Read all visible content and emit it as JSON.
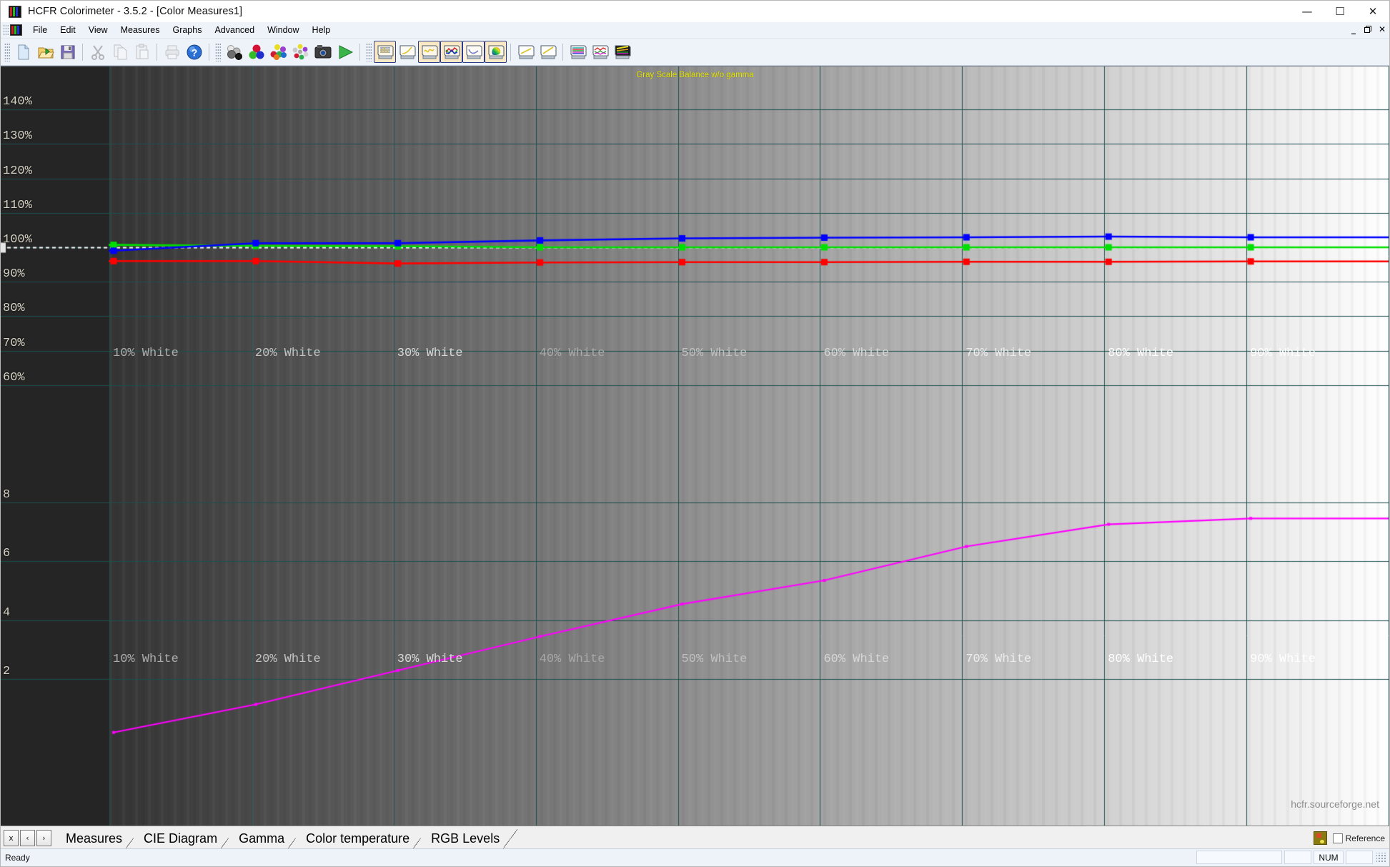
{
  "window": {
    "title": "HCFR Colorimeter - 3.5.2 - [Color Measures1]",
    "app_icon": "hcfr-rgb-icon",
    "minimize": "—",
    "maximize": "☐",
    "close": "✕"
  },
  "mdi": {
    "minimize": "_",
    "restore": "❐",
    "close": "✕"
  },
  "menu": {
    "items": [
      {
        "label": "File",
        "mnemonic": "F"
      },
      {
        "label": "Edit",
        "mnemonic": "E"
      },
      {
        "label": "View",
        "mnemonic": "V"
      },
      {
        "label": "Measures",
        "mnemonic": "M"
      },
      {
        "label": "Graphs",
        "mnemonic": "G"
      },
      {
        "label": "Advanced",
        "mnemonic": "A"
      },
      {
        "label": "Window",
        "mnemonic": "W"
      },
      {
        "label": "Help",
        "mnemonic": "H"
      }
    ]
  },
  "toolbar": {
    "groups": [
      {
        "buttons": [
          {
            "name": "new-document-icon",
            "tip": "New"
          },
          {
            "name": "open-folder-icon",
            "tip": "Open"
          },
          {
            "name": "save-floppy-icon",
            "tip": "Save"
          }
        ]
      },
      {
        "buttons": [
          {
            "name": "cut-scissors-icon",
            "tip": "Cut",
            "disabled": true
          },
          {
            "name": "copy-pages-icon",
            "tip": "Copy",
            "disabled": true
          },
          {
            "name": "paste-clipboard-icon",
            "tip": "Paste",
            "disabled": true
          }
        ]
      },
      {
        "buttons": [
          {
            "name": "print-icon",
            "tip": "Print",
            "disabled": true
          },
          {
            "name": "help-question-icon",
            "tip": "Help"
          }
        ]
      },
      {
        "buttons": [
          {
            "name": "grayscale-spheres-icon",
            "tip": "Grayscale measures"
          },
          {
            "name": "primary-colors-icon",
            "tip": "Primary colors"
          },
          {
            "name": "secondary-colors-icon",
            "tip": "Secondary colors"
          },
          {
            "name": "color-ring-icon",
            "tip": "Color checker"
          },
          {
            "name": "camera-icon",
            "tip": "Capture"
          },
          {
            "name": "run-play-icon",
            "tip": "Run measures"
          }
        ]
      },
      {
        "buttons": [
          {
            "name": "graph-measures-icon",
            "tip": "Measures",
            "selected": true
          },
          {
            "name": "graph-gamma-curve-icon",
            "tip": "Luminance"
          },
          {
            "name": "graph-yellow-wave-icon",
            "tip": "Gamma",
            "selected": true
          },
          {
            "name": "graph-rgb-levels-icon",
            "tip": "RGB Levels",
            "selected": true
          },
          {
            "name": "graph-color-temp-icon",
            "tip": "Color temperature",
            "selected": true
          },
          {
            "name": "graph-cie-diagram-icon",
            "tip": "CIE Diagram",
            "selected": true
          }
        ]
      },
      {
        "buttons": [
          {
            "name": "graph-line-plain-icon",
            "tip": "Graph A"
          },
          {
            "name": "graph-line-yellow-icon",
            "tip": "Graph B"
          }
        ]
      },
      {
        "buttons": [
          {
            "name": "graph-multi-lines-icon",
            "tip": "Multi lines"
          },
          {
            "name": "graph-rgb-wave-icon",
            "tip": "RGB wave"
          },
          {
            "name": "graph-dark-bands-icon",
            "tip": "Bands"
          }
        ]
      }
    ]
  },
  "chart_data": {
    "type": "line",
    "title": "Gray Scale Balance w/o gamma",
    "watermark": "hcfr.sourceforge.net",
    "xlabel": "",
    "ylabel": "",
    "grid": true,
    "legend": "none",
    "background": "grayscale-ramp",
    "categories": [
      "10% White",
      "20% White",
      "30% White",
      "40% White",
      "50% White",
      "60% White",
      "70% White",
      "80% White",
      "90% White"
    ],
    "rgb_axis": {
      "ylim": [
        55,
        145
      ],
      "ticks": [
        "140%",
        "130%",
        "120%",
        "110%",
        "100%",
        "90%",
        "80%",
        "70%",
        "60%"
      ],
      "tick_values": [
        140,
        130,
        120,
        110,
        100,
        90,
        80,
        70,
        60
      ],
      "reference_line": 100
    },
    "delta_axis": {
      "ylim": [
        0,
        9.2
      ],
      "ticks": [
        "8",
        "6",
        "4",
        "2"
      ],
      "tick_values": [
        8,
        6,
        4,
        2
      ]
    },
    "series": [
      {
        "name": "Red",
        "color": "#ff0000",
        "axis": "rgb",
        "values": [
          96.0,
          96.0,
          95.3,
          95.6,
          95.7,
          95.7,
          95.8,
          95.8,
          95.9
        ]
      },
      {
        "name": "Green",
        "color": "#00e000",
        "axis": "rgb",
        "values": [
          100.7,
          100.4,
          100.3,
          100.0,
          100.0,
          100.0,
          100.0,
          100.0,
          100.0
        ]
      },
      {
        "name": "Blue",
        "color": "#0000ff",
        "axis": "rgb",
        "values": [
          99.0,
          101.2,
          101.2,
          102.0,
          102.6,
          102.8,
          102.9,
          103.1,
          102.9
        ]
      },
      {
        "name": "Delta E",
        "color": "#ff00ff",
        "axis": "delta",
        "values": [
          0.2,
          1.15,
          2.3,
          3.45,
          4.55,
          5.35,
          6.5,
          7.25,
          7.45
        ]
      }
    ]
  },
  "tabstrip": {
    "nav_close": "x",
    "nav_prev": "‹",
    "nav_next": "›",
    "tabs": [
      {
        "label": "Measures",
        "active": false
      },
      {
        "label": "CIE Diagram",
        "active": false
      },
      {
        "label": "Gamma",
        "active": false
      },
      {
        "label": "Color temperature",
        "active": false
      },
      {
        "label": "RGB Levels",
        "active": true
      }
    ],
    "reference_label": "Reference",
    "reference_checked": false
  },
  "statusbar": {
    "message": "Ready",
    "panes": [
      "",
      "",
      "NUM",
      ""
    ]
  }
}
